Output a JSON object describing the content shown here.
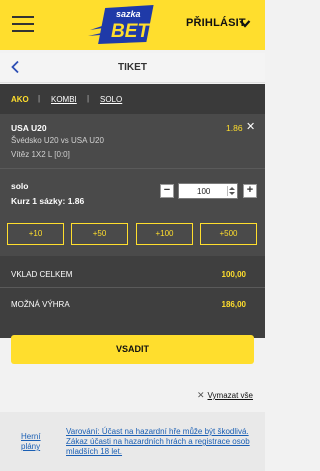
{
  "header": {
    "brand_top": "sazka",
    "brand_bottom": "BET",
    "login_label": "PŘIHLÁSIT",
    "colors": {
      "brand_yellow": "#ffde2d",
      "brand_blue": "#1f3aa8"
    }
  },
  "nav": {
    "title": "TIKET"
  },
  "tabs": [
    {
      "label": "AKO",
      "active": true
    },
    {
      "label": "KOMBI",
      "active": false
    },
    {
      "label": "SOLO",
      "active": false
    }
  ],
  "tab_separator": "|",
  "bet": {
    "title": "USA U20",
    "odds": "1.86",
    "close_symbol": "✕",
    "match": "Švédsko U20 vs USA U20",
    "market": "Vítěz 1X2 L [0:0]"
  },
  "stake": {
    "name": "solo",
    "odds_label": "Kurz 1 sázky: 1.86",
    "value": "100",
    "minus": "−",
    "plus": "+"
  },
  "quick_amounts": [
    "+10",
    "+50",
    "+100",
    "+500"
  ],
  "totals": {
    "deposit_label": "VKLAD CELKEM",
    "deposit_value": "100,00",
    "win_label": "MOŽNÁ VÝHRA",
    "win_value": "186,00"
  },
  "submit_label": "VSADIT",
  "clear": {
    "symbol": "✕",
    "label": "Vymazat vše"
  },
  "footer": {
    "rules_label": "Herní plány",
    "warning": "Varování: Účast na hazardní hře může být škodlivá. Zákaz účasti na hazardních hrách a registrace osob mladších 18 let."
  }
}
